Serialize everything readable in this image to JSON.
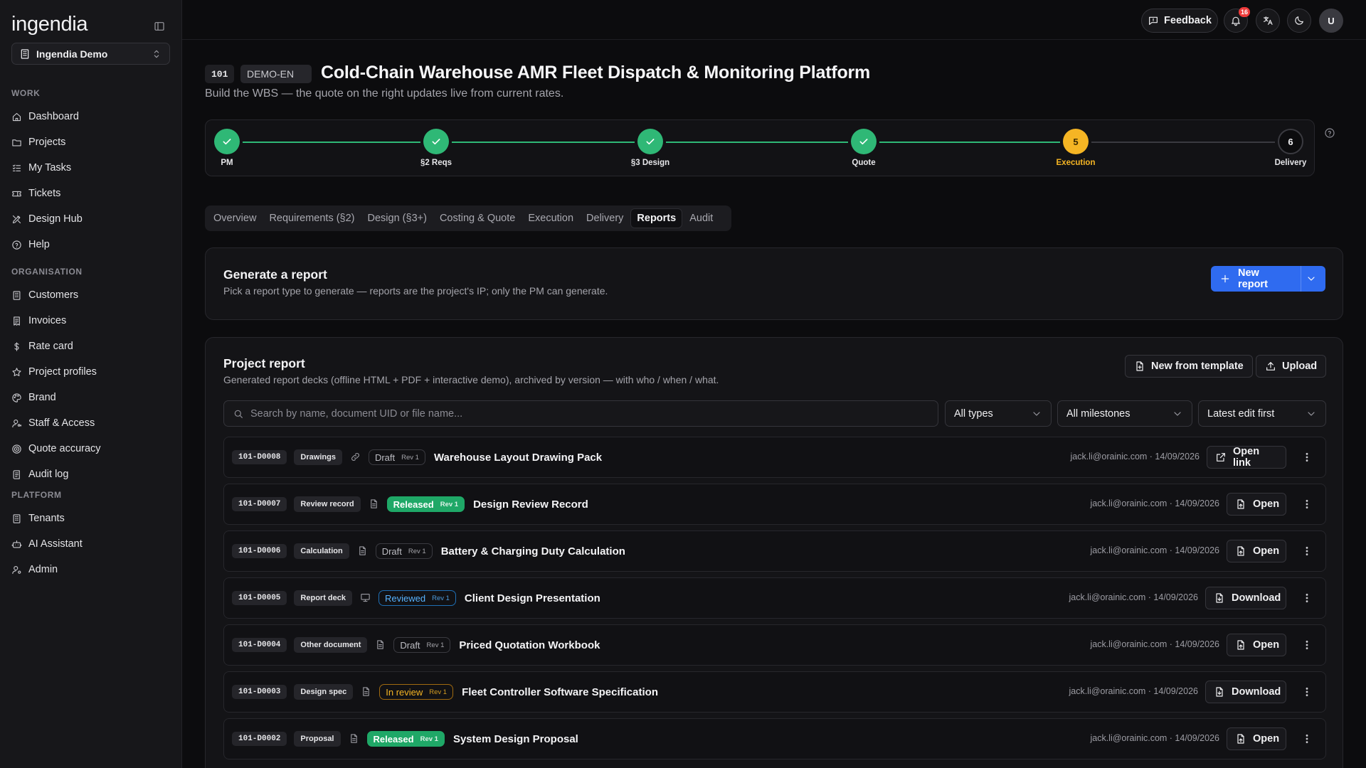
{
  "app": {
    "logo": "ingendia",
    "tenant": "Ingendia Demo"
  },
  "sidebar": {
    "sections": [
      {
        "label": "WORK",
        "items": [
          {
            "label": "Dashboard",
            "icon": "home-icon"
          },
          {
            "label": "Projects",
            "icon": "folder-icon"
          },
          {
            "label": "My Tasks",
            "icon": "list-check-icon"
          },
          {
            "label": "Tickets",
            "icon": "ticket-icon"
          },
          {
            "label": "Design Hub",
            "icon": "design-icon"
          },
          {
            "label": "Help",
            "icon": "help-circle-icon"
          }
        ]
      },
      {
        "label": "ORGANISATION",
        "items": [
          {
            "label": "Customers",
            "icon": "building-icon"
          },
          {
            "label": "Invoices",
            "icon": "receipt-icon"
          },
          {
            "label": "Rate card",
            "icon": "dollar-icon"
          },
          {
            "label": "Project profiles",
            "icon": "star-icon"
          },
          {
            "label": "Brand",
            "icon": "palette-icon"
          },
          {
            "label": "Staff & Access",
            "icon": "user-key-icon"
          },
          {
            "label": "Quote accuracy",
            "icon": "target-icon"
          },
          {
            "label": "Audit log",
            "icon": "log-icon"
          }
        ]
      },
      {
        "label": "PLATFORM",
        "items": [
          {
            "label": "Tenants",
            "icon": "building-icon"
          },
          {
            "label": "AI Assistant",
            "icon": "bot-icon"
          },
          {
            "label": "Admin",
            "icon": "user-cog-icon"
          }
        ]
      }
    ]
  },
  "topbar": {
    "feedback_label": "Feedback",
    "notifications_count": "16",
    "avatar_initial": "U"
  },
  "project": {
    "number": "101",
    "code": "DEMO-EN",
    "title": "Cold-Chain Warehouse AMR Fleet Dispatch & Monitoring Platform",
    "subtitle": "Build the WBS — the quote on the right updates live from current rates."
  },
  "stepper": {
    "steps": [
      {
        "label": "PM",
        "state": "done",
        "marker": ""
      },
      {
        "label": "§2 Reqs",
        "state": "done",
        "marker": ""
      },
      {
        "label": "§3 Design",
        "state": "done",
        "marker": ""
      },
      {
        "label": "Quote",
        "state": "done",
        "marker": ""
      },
      {
        "label": "Execution",
        "state": "current",
        "marker": "5"
      },
      {
        "label": "Delivery",
        "state": "todo",
        "marker": "6"
      }
    ],
    "colors": {
      "done": "#2fb876",
      "current": "#f5b524",
      "todo": "#3a3a40"
    }
  },
  "tabs": [
    {
      "label": "Overview",
      "active": false
    },
    {
      "label": "Requirements (§2)",
      "active": false
    },
    {
      "label": "Design (§3+)",
      "active": false
    },
    {
      "label": "Costing & Quote",
      "active": false
    },
    {
      "label": "Execution",
      "active": false
    },
    {
      "label": "Delivery",
      "active": false
    },
    {
      "label": "Reports",
      "active": true
    },
    {
      "label": "Audit",
      "active": false
    }
  ],
  "generate": {
    "title": "Generate a report",
    "description": "Pick a report type to generate — reports are the project's IP; only the PM can generate.",
    "new_report_label": "New report"
  },
  "project_report": {
    "title": "Project report",
    "description": "Generated report decks (offline HTML + PDF + interactive demo), archived by version — with who / when / what.",
    "new_from_template_label": "New from template",
    "upload_label": "Upload",
    "search_placeholder": "Search by name, document UID or file name...",
    "filters": {
      "type": "All types",
      "milestone": "All milestones",
      "sort": "Latest edit first"
    },
    "documents": [
      {
        "uid": "101-D0008",
        "type": "Drawings",
        "kind_icon": "link-icon",
        "status": "Draft",
        "status_class": "draft",
        "rev": "Rev 1",
        "title": "Warehouse Layout Drawing Pack",
        "meta": "jack.li@orainic.com · 14/09/2026",
        "action": "Open link",
        "action_icon": "external-link-icon"
      },
      {
        "uid": "101-D0007",
        "type": "Review record",
        "kind_icon": "file-icon",
        "status": "Released",
        "status_class": "released",
        "rev": "Rev 1",
        "title": "Design Review Record",
        "meta": "jack.li@orainic.com · 14/09/2026",
        "action": "Open",
        "action_icon": "file-open-icon"
      },
      {
        "uid": "101-D0006",
        "type": "Calculation",
        "kind_icon": "file-icon",
        "status": "Draft",
        "status_class": "draft",
        "rev": "Rev 1",
        "title": "Battery & Charging Duty Calculation",
        "meta": "jack.li@orainic.com · 14/09/2026",
        "action": "Open",
        "action_icon": "file-open-icon"
      },
      {
        "uid": "101-D0005",
        "type": "Report deck",
        "kind_icon": "presentation-icon",
        "status": "Reviewed",
        "status_class": "reviewed",
        "rev": "Rev 1",
        "title": "Client Design Presentation",
        "meta": "jack.li@orainic.com · 14/09/2026",
        "action": "Download",
        "action_icon": "file-download-icon"
      },
      {
        "uid": "101-D0004",
        "type": "Other document",
        "kind_icon": "file-icon",
        "status": "Draft",
        "status_class": "draft",
        "rev": "Rev 1",
        "title": "Priced Quotation Workbook",
        "meta": "jack.li@orainic.com · 14/09/2026",
        "action": "Open",
        "action_icon": "file-open-icon"
      },
      {
        "uid": "101-D0003",
        "type": "Design spec",
        "kind_icon": "file-icon",
        "status": "In review",
        "status_class": "inreview",
        "rev": "Rev 1",
        "title": "Fleet Controller Software Specification",
        "meta": "jack.li@orainic.com · 14/09/2026",
        "action": "Download",
        "action_icon": "file-download-icon"
      },
      {
        "uid": "101-D0002",
        "type": "Proposal",
        "kind_icon": "file-icon",
        "status": "Released",
        "status_class": "released",
        "rev": "Rev 1",
        "title": "System Design Proposal",
        "meta": "jack.li@orainic.com · 14/09/2026",
        "action": "Open",
        "action_icon": "file-open-icon"
      }
    ]
  },
  "colors": {
    "accent": "#2f6bf0",
    "released": "#1fa867",
    "reviewed": "#58b3ff",
    "in_review": "#f5b524",
    "background": "#0c0c0e"
  }
}
